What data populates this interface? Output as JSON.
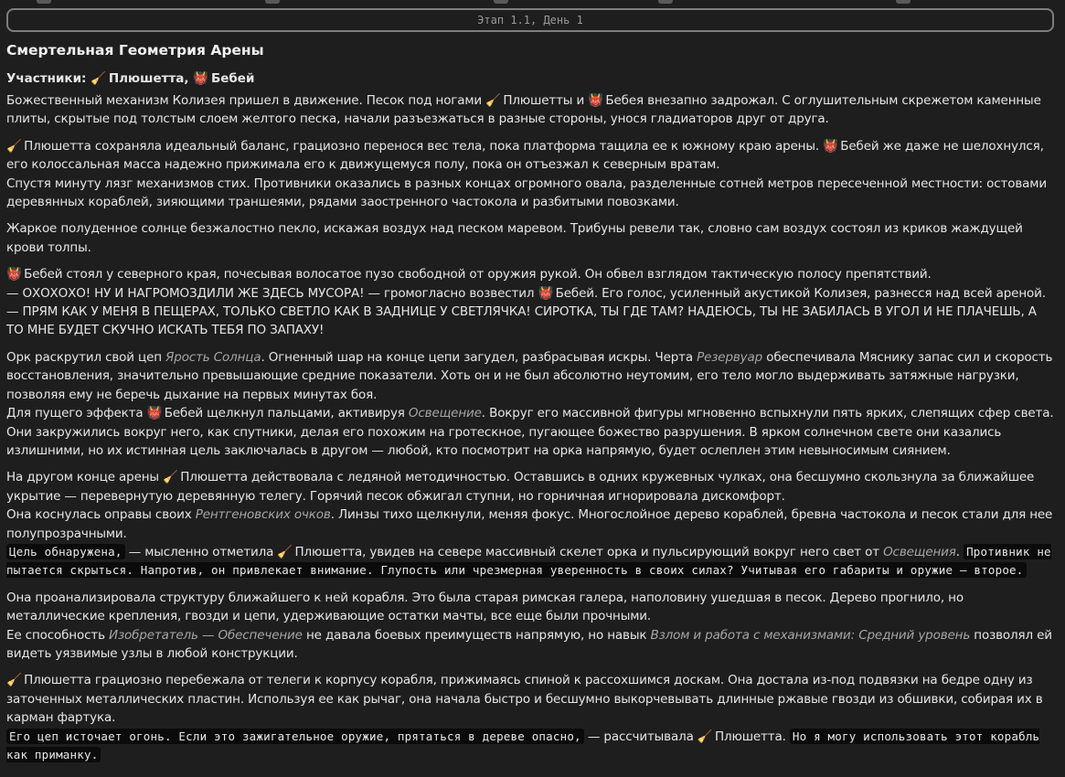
{
  "stage": "Этап 1.1, День 1",
  "title": "Смертельная Геометрия Арены",
  "participants": {
    "label": "Участники:",
    "names": [
      "Плюшетта",
      "Бебей"
    ],
    "sep": ","
  },
  "icons": {
    "plushetta": "broom-icon",
    "bebey": "devil-icon"
  },
  "colors": {
    "background": "#1e1e1e",
    "text": "#e6e6e6",
    "italic": "#a6a6a6",
    "code_bg": "#0b0b0b"
  },
  "text": {
    "p1a": "Божественный механизм Колизея пришел в движение. Песок под ногами ",
    "p1b": " Плюшетты и ",
    "p1c": " Бебея внезапно задрожал. С оглушительным скрежетом каменные плиты, скрытые под толстым слоем желтого песка, начали разъезжаться в разные стороны, унося гладиаторов друг от друга.",
    "p2a": " Плюшетта сохраняла идеальный баланс, грациозно перенося вес тела, пока платформа тащила ее к южному краю арены. ",
    "p2b": " Бебей же даже не шелохнулся, его колоссальная масса надежно прижимала его к движущемуся полу, пока он отъезжал к северным вратам.",
    "p2c": "Спустя минуту лязг механизмов стих. Противники оказались в разных концах огромного овала, разделенные сотней метров пересеченной местности: остовами деревянных кораблей, зияющими траншеями, рядами заостренного частокола и разбитыми повозками.",
    "p3": "Жаркое полуденное солнце безжалостно пекло, искажая воздух над песком маревом. Трибуны ревели так, словно сам воздух состоял из криков жаждущей крови толпы.",
    "p4a": " Бебей стоял у северного края, почесывая волосатое пузо свободной от оружия рукой. Он обвел взглядом тактическую полосу препятствий.",
    "p4b": "— ОХОХОХО! НУ И НАГРОМОЗДИЛИ ЖЕ ЗДЕСЬ МУСОРА! — громогласно возвестил ",
    "p4c": " Бебей. Его голос, усиленный акустикой Колизея, разнесся над всей ареной. — ПРЯМ КАК У МЕНЯ В ПЕЩЕРАХ, ТОЛЬКО СВЕТЛО КАК В ЗАДНИЦЕ У СВЕТЛЯЧКА! СИРОТКА, ТЫ ГДЕ ТАМ? НАДЕЮСЬ, ТЫ НЕ ЗАБИЛАСЬ В УГОЛ И НЕ ПЛАЧЕШЬ, А ТО МНЕ БУДЕТ СКУЧНО ИСКАТЬ ТЕБЯ ПО ЗАПАХУ!",
    "p5a": "Орк раскрутил свой цеп ",
    "p5_em1": "Ярость Солнца",
    "p5b": ". Огненный шар на конце цепи загудел, разбрасывая искры. Черта ",
    "p5_em2": "Резервуар",
    "p5c": " обеспечивала Мяснику запас сил и скорость восстановления, значительно превышающие средние показатели. Хоть он и не был абсолютно неутомим, его тело могло выдерживать затяжные нагрузки, позволяя ему не беречь дыхание на первых минутах боя.",
    "p5d": "Для пущего эффекта ",
    "p5e": " Бебей щелкнул пальцами, активируя ",
    "p5_em3": "Освещение",
    "p5f": ". Вокруг его массивной фигуры мгновенно вспыхнули пять ярких, слепящих сфер света. Они закружились вокруг него, как спутники, делая его похожим на гротескное, пугающее божество разрушения. В ярком солнечном свете они казались излишними, но их истинная цель заключалась в другом — любой, кто посмотрит на орка напрямую, будет ослеплен этим невыносимым сиянием.",
    "p6a": "На другом конце арены ",
    "p6b": " Плюшетта действовала с ледяной методичностью. Оставшись в одних кружевных чулках, она бесшумно скользнула за ближайшее укрытие — перевернутую деревянную телегу. Горячий песок обжигал ступни, но горничная игнорировала дискомфорт.",
    "p6c": "Она коснулась оправы своих ",
    "p6_em1": "Рентгеновских очков",
    "p6d": ". Линзы тихо щелкнули, меняя фокус. Многослойное дерево кораблей, бревна частокола и песок стали для нее полупрозрачными.",
    "p6_code1": "Цель обнаружена,",
    "p6e": " — мысленно отметила ",
    "p6f": " Плюшетта, увидев на севере массивный скелет орка и пульсирующий вокруг него свет от ",
    "p6_em2": "Освещения",
    "p6g": ". ",
    "p6_code2": "Противник не пытается скрыться. Напротив, он привлекает внимание. Глупость или чрезмерная уверенность в своих силах? Учитывая его габариты и оружие — второе.",
    "p7a": "Она проанализировала структуру ближайшего к ней корабля. Это была старая римская галера, наполовину ушедшая в песок. Дерево прогнило, но металлические крепления, гвозди и цепи, удерживающие остатки мачты, все еще были прочными.",
    "p7b": "Ее способность ",
    "p7_em1": "Изобретатель — Обеспечение",
    "p7c": " не давала боевых преимуществ напрямую, но навык ",
    "p7_em2": "Взлом и работа с механизмами: Средний уровень",
    "p7d": " позволял ей видеть уязвимые узлы в любой конструкции.",
    "p8a": " Плюшетта грациозно перебежала от телеги к корпусу корабля, прижимаясь спиной к рассохшимся доскам. Она достала из-под подвязки на бедре одну из заточенных металлических пластин. Используя ее как рычаг, она начала быстро и бесшумно выкорчевывать длинные ржавые гвозди из обшивки, собирая их в карман фартука.",
    "p8_code1": "Его цеп источает огонь. Если это зажигательное оружие, прятаться в дереве опасно,",
    "p8b": " — рассчитывала ",
    "p8c": " Плюшетта. ",
    "p8_code2": "Но я могу использовать этот корабль как приманку."
  }
}
